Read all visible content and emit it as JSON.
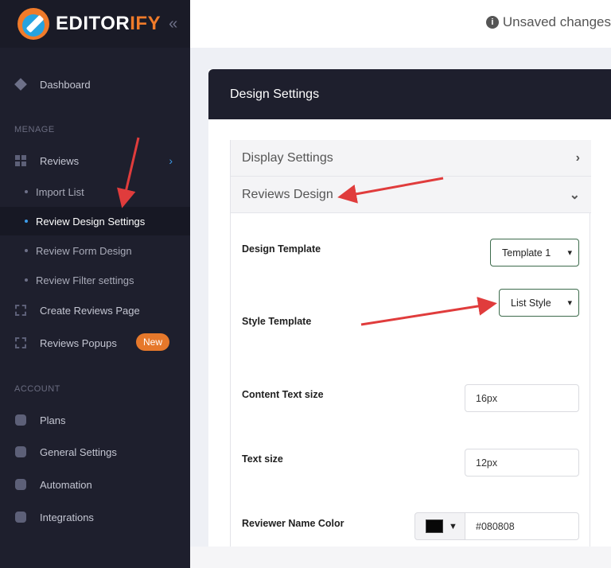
{
  "brand": {
    "name_main": "EDITOR",
    "name_accent": "IFY",
    "accent_color": "#f07b2a"
  },
  "topbar": {
    "unsaved_text": "Unsaved changes"
  },
  "sidebar": {
    "dashboard": "Dashboard",
    "section_manage": "MENAGE",
    "reviews": "Reviews",
    "sub_items": [
      "Import List",
      "Review Design Settings",
      "Review Form Design",
      "Review Filter settings"
    ],
    "create_reviews_page": "Create Reviews Page",
    "reviews_popups": "Reviews Popups",
    "new_badge": "New",
    "section_account": "ACCOUNT",
    "account_items": [
      "Plans",
      "General Settings",
      "Automation",
      "Integrations"
    ]
  },
  "card": {
    "title": "Design Settings",
    "display_settings": "Display Settings",
    "reviews_design": "Reviews Design",
    "fields": {
      "design_template_label": "Design Template",
      "design_template_value": "Template 1",
      "style_template_label": "Style Template",
      "style_template_value": "List Style",
      "content_text_size_label": "Content Text size",
      "content_text_size_value": "16px",
      "text_size_label": "Text size",
      "text_size_value": "12px",
      "reviewer_name_color_label": "Reviewer Name Color",
      "reviewer_name_color_value": "#080808"
    }
  },
  "colors": {
    "sidebar_bg": "#1e1f2d",
    "active_dot": "#3d9be9",
    "badge": "#e6782b",
    "annotation_arrow": "#e03c3c"
  }
}
